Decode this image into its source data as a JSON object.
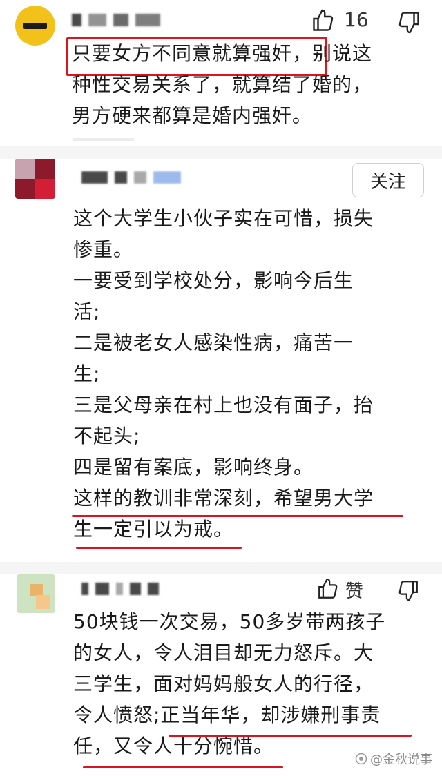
{
  "comments": [
    {
      "likes": "16",
      "lines": [
        "只要女方不同意就算强奸，别说这",
        "种性交易关系了，就算结了婚的，",
        "男方硬来都算是婚内强奸。"
      ],
      "highlighted_phrase": "只要女方不同意就算强奸"
    },
    {
      "follow_label": "关注",
      "lines": [
        "这个大学生小伙子实在可惜，损失",
        "惨重。",
        "一要受到学校处分，影响今后生",
        "活;",
        "二是被老女人感染性病，痛苦一",
        "生;",
        "三是父母亲在村上也没有面子，抬",
        "不起头;",
        "四是留有案底，影响终身。",
        "这样的教训非常深刻，希望男大学",
        "生一定引以为戒。"
      ]
    },
    {
      "like_label": "赞",
      "lines": [
        "50块钱一次交易，50多岁带两孩子",
        "的女人，令人泪目却无力怒斥。大",
        "三学生，面对妈妈般女人的行径，",
        "令人愤怒;正当年华，却涉嫌刑事责",
        "任，又令人十分惋惜。"
      ]
    }
  ],
  "watermark": "@金秋说事",
  "colors": {
    "highlight_red": "#e0141e",
    "text": "#1a1a1a",
    "divider": "#f5f5f5"
  },
  "icons": [
    "thumbs-up-icon",
    "thumbs-down-icon",
    "watermark-logo-icon"
  ]
}
